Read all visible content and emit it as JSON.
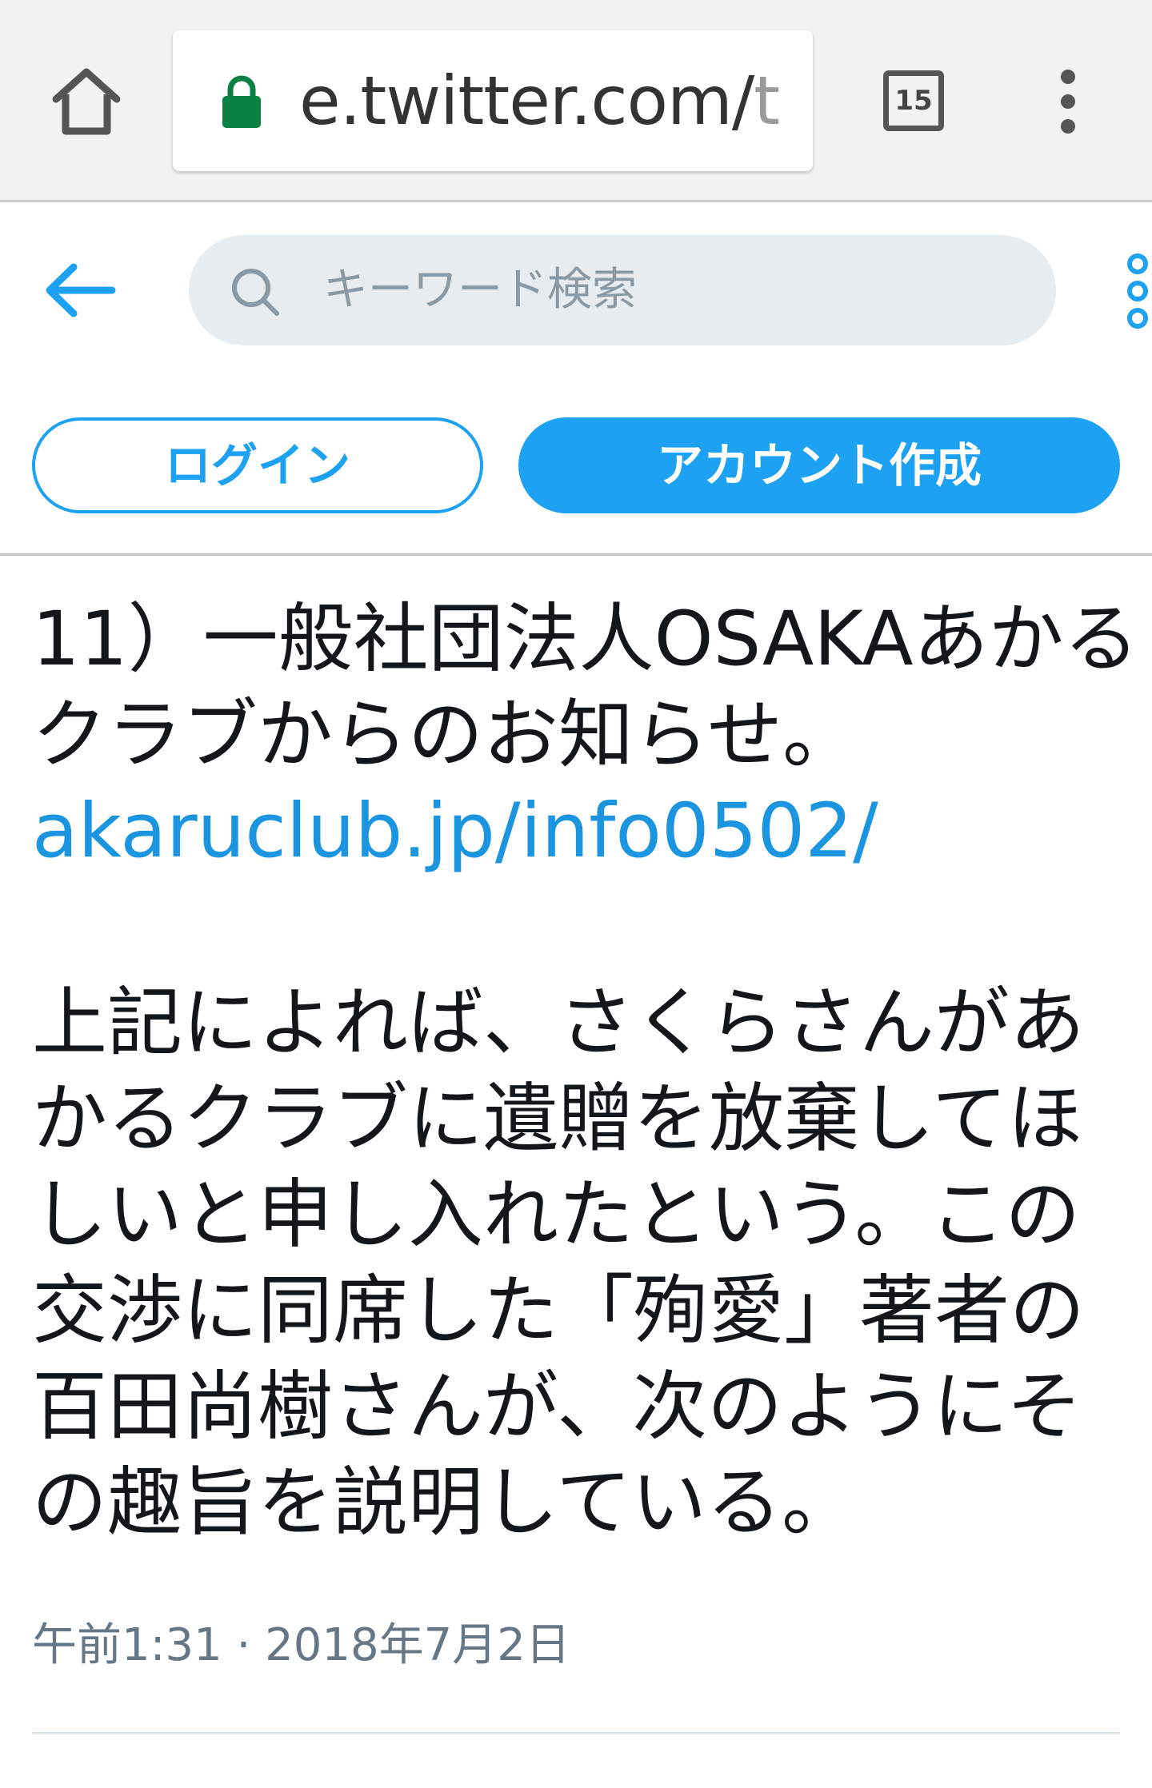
{
  "browser": {
    "url_main": "e.twitter.com/",
    "url_fade": "t",
    "tab_count": "15",
    "accent_lock": "#0b8043"
  },
  "header": {
    "search_placeholder": "キーワード検索"
  },
  "auth": {
    "login_label": "ログイン",
    "signup_label": "アカウント作成"
  },
  "tweet": {
    "lines_part1": [
      "11）一般社団法人OSAKAあかる",
      "クラブからのお知らせ。"
    ],
    "link": "akaruclub.jp/info0502/",
    "lines_part2": [
      "上記によれば、さくらさんがあ",
      "かるクラブに遺贈を放棄してほ",
      "しいと申し入れたという。この",
      "交渉に同席した「殉愛」著者の",
      "百田尚樹さんが、次のようにそ",
      "の趣旨を説明している。"
    ],
    "timestamp": "午前1:31 · 2018年7月2日"
  },
  "colors": {
    "twitter_blue": "#1da1f2",
    "link_blue": "#1b95e0",
    "text": "#14171a",
    "muted": "#657786"
  }
}
